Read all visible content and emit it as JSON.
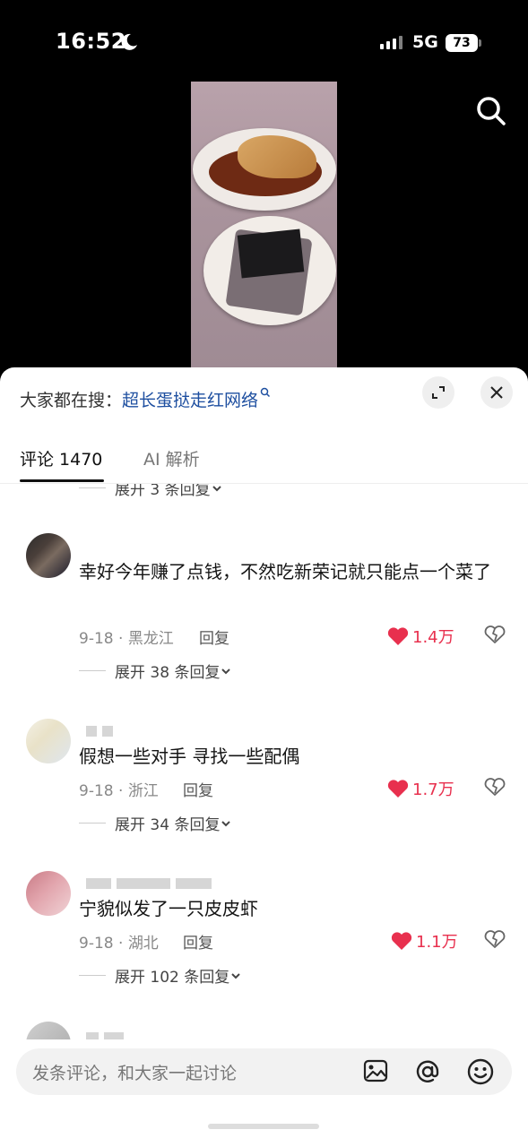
{
  "status_bar": {
    "time": "16:52",
    "network": "5G",
    "battery": "73"
  },
  "icons": {
    "search": "search-icon",
    "moon": "moon-icon",
    "expand": "expand-icon",
    "close": "close-icon",
    "heart": "heart-icon",
    "dislike": "heart-broken-icon",
    "image": "image-icon",
    "mention": "at-icon",
    "emoji": "emoji-icon"
  },
  "colors": {
    "accent_link": "#1e4fa0",
    "like_red": "#e8304e"
  },
  "search_suggest": {
    "prefix": "大家都在搜：",
    "query": "超长蛋挞走红网络"
  },
  "tabs": {
    "comments": "评论 1470",
    "ai": "AI 解析"
  },
  "top_partial_more": "展开 3 条回复",
  "comments": [
    {
      "text": "幸好今年赚了点钱，不然吃新荣记就只能点一个菜了",
      "date": "9-18",
      "region": "黑龙江",
      "reply": "回复",
      "likes": "1.4万",
      "more": "展开 38 条回复"
    },
    {
      "text": "假想一些对手 寻找一些配偶",
      "date": "9-18",
      "region": "浙江",
      "reply": "回复",
      "likes": "1.7万",
      "more": "展开 34 条回复"
    },
    {
      "text": "宁貌似发了一只皮皮虾",
      "date": "9-18",
      "region": "湖北",
      "reply": "回复",
      "likes": "1.1万",
      "more": "展开 102 条回复"
    }
  ],
  "comment_input": {
    "placeholder": "发条评论，和大家一起讨论"
  }
}
